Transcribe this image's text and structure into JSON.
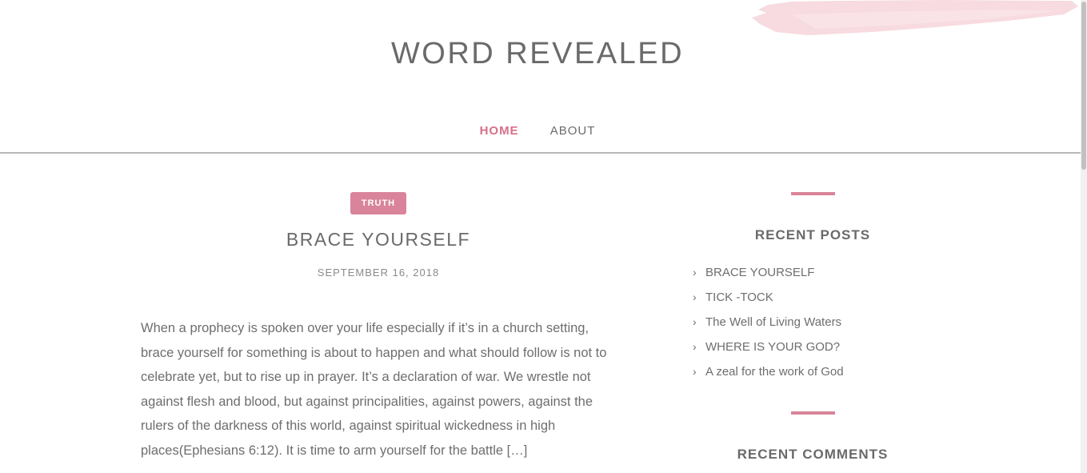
{
  "site": {
    "title": "WORD REVEALED",
    "accent_color": "#d9849a"
  },
  "nav": {
    "items": [
      {
        "label": "HOME",
        "active": true
      },
      {
        "label": "ABOUT",
        "active": false
      }
    ]
  },
  "post": {
    "category": "TRUTH",
    "title": "BRACE YOURSELF",
    "date": "SEPTEMBER 16, 2018",
    "excerpt": "When a prophecy is spoken over your life especially if it’s in a church setting, brace yourself for something is about to happen and what should follow is not to celebrate yet, but to rise up in prayer. It’s a declaration of war. We wrestle not against flesh and blood, but against principalities, against powers, against the rulers of the darkness of this world, against spiritual wickedness in high places(Ephesians 6:12). It is time to arm yourself for the battle […]"
  },
  "sidebar": {
    "recent_posts": {
      "title": "RECENT POSTS",
      "items": [
        "BRACE YOURSELF",
        "TICK -TOCK",
        "The Well of Living Waters",
        "WHERE IS YOUR GOD?",
        "A zeal for the work of God"
      ],
      "bullet_icon": "chevron-right-icon"
    },
    "recent_comments": {
      "title": "RECENT COMMENTS"
    }
  }
}
